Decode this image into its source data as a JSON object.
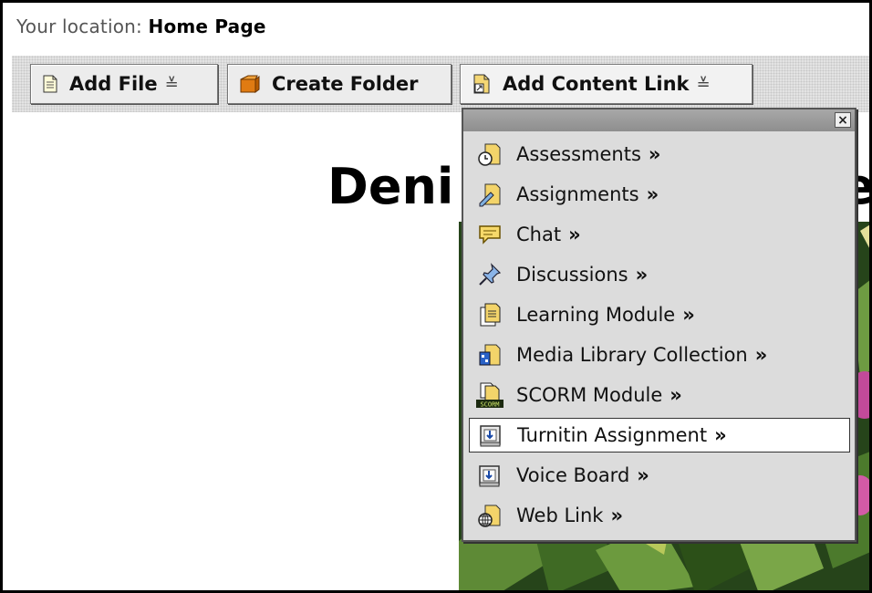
{
  "location": {
    "label": "Your location:",
    "value": "Home Page"
  },
  "toolbar": {
    "add_file": "Add File",
    "create_folder": "Create Folder",
    "add_content_link": "Add Content Link",
    "menu_arrow": "≚"
  },
  "page": {
    "heading_visible": "Deni",
    "heading_tail": "e"
  },
  "menu": {
    "close": "×",
    "chevron": "»",
    "items": [
      {
        "label": "Assessments",
        "icon": "assessment-icon"
      },
      {
        "label": "Assignments",
        "icon": "assignment-icon"
      },
      {
        "label": "Chat",
        "icon": "chat-icon"
      },
      {
        "label": "Discussions",
        "icon": "pushpin-icon"
      },
      {
        "label": "Learning Module",
        "icon": "learning-module-icon"
      },
      {
        "label": "Media Library Collection",
        "icon": "media-library-icon"
      },
      {
        "label": "SCORM Module",
        "icon": "scorm-icon"
      },
      {
        "label": "Turnitin Assignment",
        "icon": "turnitin-icon",
        "highlighted": true
      },
      {
        "label": "Voice Board",
        "icon": "voice-board-icon"
      },
      {
        "label": "Web Link",
        "icon": "web-link-icon"
      }
    ]
  }
}
